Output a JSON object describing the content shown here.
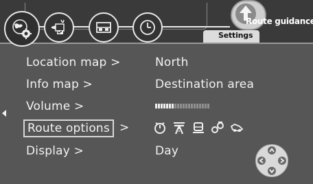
{
  "header": {
    "route_guidance_label": "Route guidance",
    "settings_tab_label": "Settings",
    "buttons": [
      {
        "icon": "globe-gear-icon"
      },
      {
        "icon": "navigation-settings-icon"
      },
      {
        "icon": "map-icon"
      },
      {
        "icon": "clock-icon"
      }
    ]
  },
  "menu": {
    "location_map": {
      "label": "Location map >",
      "value": "North"
    },
    "info_map": {
      "label": "Info map >",
      "value": "Destination area"
    },
    "volume": {
      "label": "Volume >",
      "level": 0.35,
      "segments_total": 20
    },
    "route_options": {
      "label": "Route options",
      "arrow": ">",
      "icons": [
        "time-icon",
        "highway-icon",
        "train-icon",
        "ferry-icon",
        "car-icon"
      ]
    },
    "display": {
      "label": "Display >",
      "value": "Day"
    }
  },
  "colors": {
    "background": "#565656",
    "header": "#3a3a3a",
    "text": "#f2f2f2"
  }
}
